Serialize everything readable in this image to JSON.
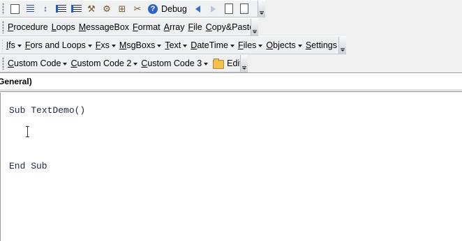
{
  "toolbar1": {
    "icons": [
      "comment-block-icon",
      "numbered-lines-icon",
      "sort-az-icon",
      "outdent-icon",
      "indent-icon",
      "reference-icon",
      "wrench-icon",
      "tree-icon",
      "tools-icon",
      "help-icon"
    ],
    "debug_label": "Debug",
    "nav_icons": [
      "arrow-left-icon",
      "arrow-right-icon",
      "document-icon",
      "document-copy-icon"
    ]
  },
  "toolbar2": {
    "items": [
      "Procedure",
      "Loops",
      "MessageBox",
      "Format",
      "Array",
      "File",
      "Copy&Paste"
    ]
  },
  "toolbar3": {
    "items": [
      "Ifs",
      "Fors and Loops",
      "Fxs",
      "MsgBoxs",
      "Text",
      "DateTime",
      "Files",
      "Objects",
      "Settings"
    ]
  },
  "toolbar4": {
    "items": [
      "Custom Code",
      "Custom Code 2",
      "Custom Code 3"
    ],
    "edit_label": "Edit"
  },
  "object_dropdown": {
    "value": "General)"
  },
  "code": {
    "lines": [
      "Sub TextDemo()",
      "End Sub"
    ]
  },
  "colors": {
    "toolbar_bg": "#eef0f2",
    "editor_bg": "#ffffff",
    "code_text": "#1a2a44"
  }
}
